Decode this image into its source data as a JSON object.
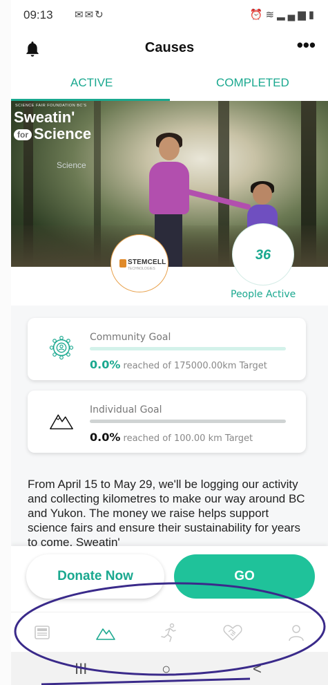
{
  "status_bar": {
    "time": "09:13",
    "left_icons": "M M C",
    "right_icons": "alarm wifi signal battery"
  },
  "app_bar": {
    "title": "Causes",
    "more_label": "•••"
  },
  "tabs": [
    {
      "label": "ACTIVE",
      "selected": true
    },
    {
      "label": "COMPLETED",
      "selected": false
    }
  ],
  "hero": {
    "brand_small": "SCIENCE FAIR FOUNDATION BC'S",
    "brand_line1": "Sweatin'",
    "brand_for": "for",
    "brand_line2": "Science",
    "faint_text": "Science"
  },
  "sponsor": {
    "name": "STEMCELL",
    "sub": "TECHNOLOGIES"
  },
  "people": {
    "count": "36",
    "label": "People Active"
  },
  "goals": {
    "community": {
      "title": "Community Goal",
      "percent": "0.0%",
      "detail": "reached of 175000.00km Target",
      "progress": 0.0
    },
    "individual": {
      "title": "Individual Goal",
      "percent": "0.0%",
      "detail": "reached of 100.00 km Target",
      "progress": 0.0
    }
  },
  "description": "From April 15 to May 29, we'll be logging our activity and collecting kilometres to make our way around BC and Yukon. The money we raise helps support science fairs and ensure their sustainability for years to come. Sweatin'",
  "actions": {
    "donate_label": "Donate Now",
    "go_label": "GO"
  },
  "bottom_nav": [
    {
      "icon": "newsfeed-icon",
      "active": false
    },
    {
      "icon": "mountain-icon",
      "active": true
    },
    {
      "icon": "runner-icon",
      "active": false
    },
    {
      "icon": "heart-handshake-icon",
      "active": false
    },
    {
      "icon": "profile-icon",
      "active": false
    }
  ],
  "system_nav": {
    "recents": "III",
    "home": "○",
    "back": "<"
  },
  "colors": {
    "accent": "#1aa88f",
    "go_button": "#1fc29a",
    "annotation": "#3a2a8a"
  }
}
